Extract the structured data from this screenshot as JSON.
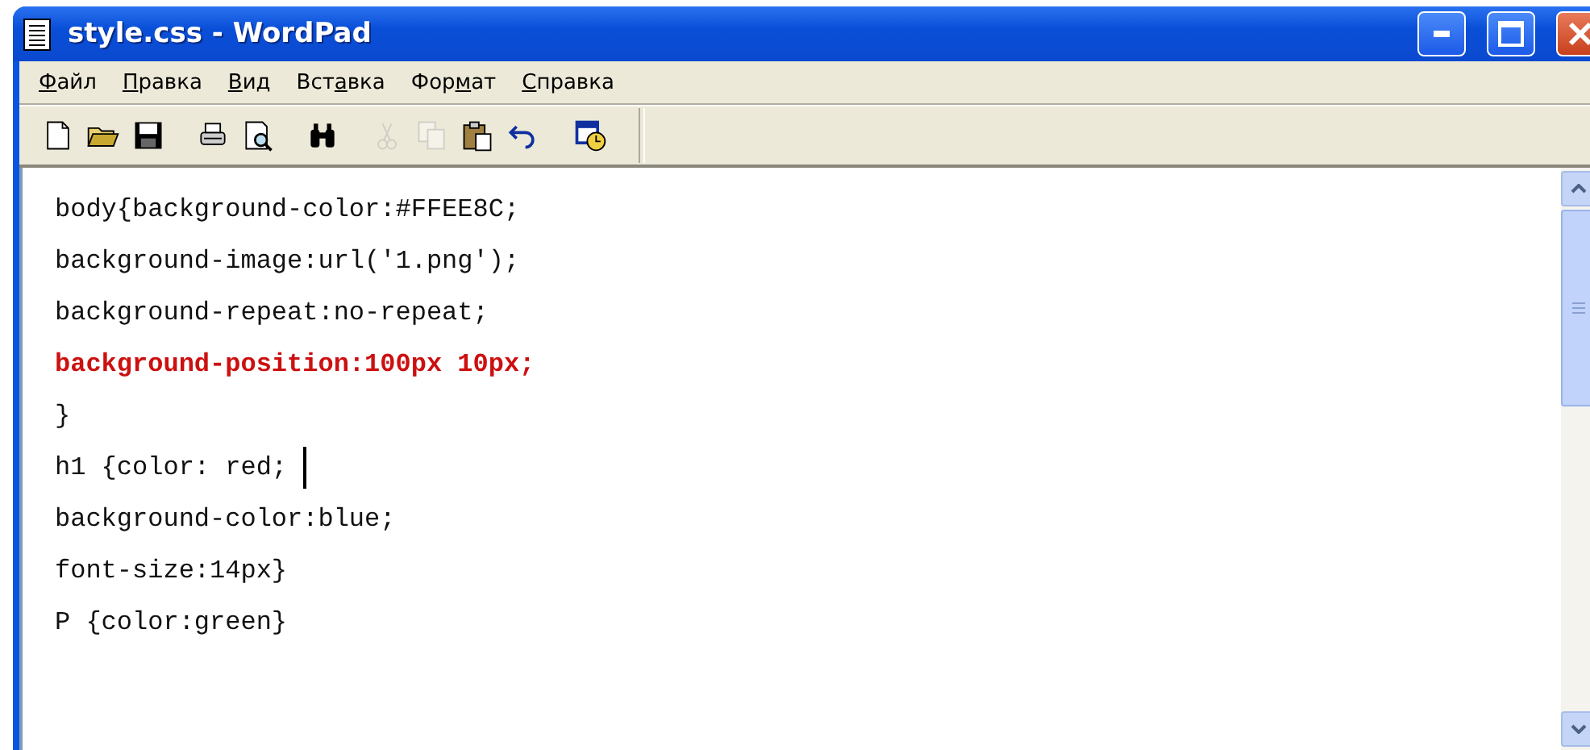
{
  "window": {
    "title": "style.css - WordPad"
  },
  "menu": [
    {
      "key": "Ф",
      "post": "айл"
    },
    {
      "key": "П",
      "post": "равка"
    },
    {
      "key": "В",
      "post": "ид"
    },
    {
      "pre": "Вст",
      "key": "а",
      "post": "вка"
    },
    {
      "pre": "Фор",
      "key": "м",
      "post": "ат"
    },
    {
      "key": "С",
      "post": "правка"
    }
  ],
  "toolbar": [
    {
      "disabled": false
    },
    {
      "disabled": false
    },
    {
      "disabled": false
    },
    {
      "disabled": false
    },
    {
      "disabled": false
    },
    {
      "disabled": false
    },
    {
      "disabled": true
    },
    {
      "disabled": true
    },
    {
      "disabled": false
    },
    {
      "disabled": false
    },
    {
      "disabled": false
    }
  ],
  "document": {
    "lines": [
      {
        "text": "body{background-color:#FFEE8C;",
        "highlighted": false,
        "cursor": false
      },
      {
        "text": "background-image:url('1.png');",
        "highlighted": false,
        "cursor": false
      },
      {
        "text": "background-repeat:no-repeat;",
        "highlighted": false,
        "cursor": false
      },
      {
        "text": "background-position:100px 10px;",
        "highlighted": true,
        "cursor": false
      },
      {
        "text": "}",
        "highlighted": false,
        "cursor": false
      },
      {
        "text": "h1 {color: red; ",
        "highlighted": false,
        "cursor": true
      },
      {
        "text": "background-color:blue;",
        "highlighted": false,
        "cursor": false
      },
      {
        "text": "font-size:14px}",
        "highlighted": false,
        "cursor": false
      },
      {
        "text": "P {color:green}",
        "highlighted": false,
        "cursor": false
      }
    ]
  }
}
